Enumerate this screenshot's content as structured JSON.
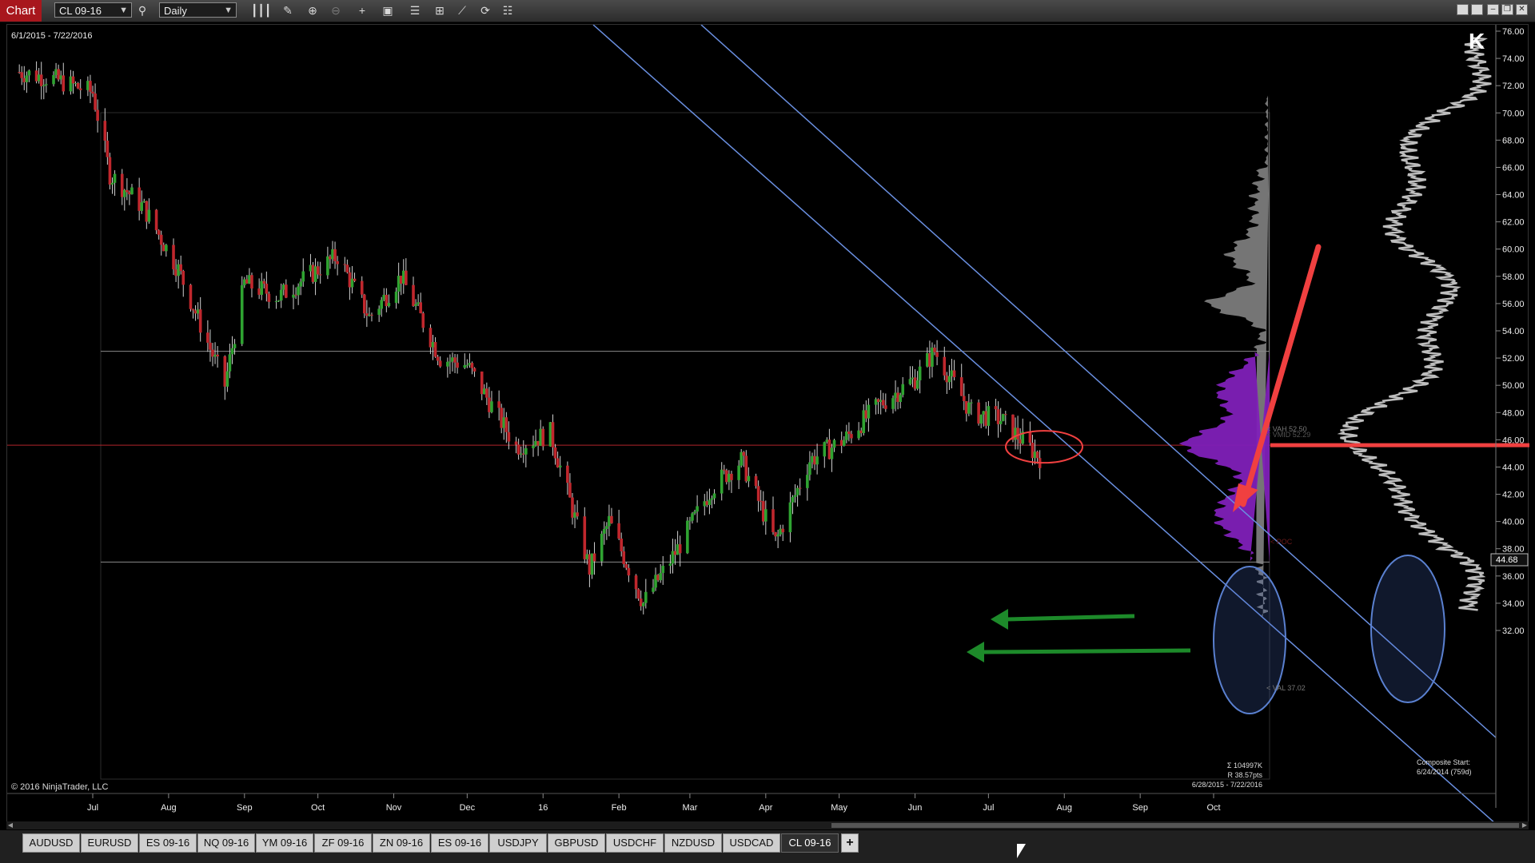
{
  "toolbar": {
    "app_label": "Chart",
    "instrument": "CL 09-16",
    "period": "Daily",
    "icons": [
      "search-icon",
      "bar-type-icon",
      "pencil-icon",
      "zoom-in-icon",
      "zoom-out-icon",
      "crosshair-icon",
      "data-box-icon",
      "indicators-icon",
      "strategies-icon",
      "drawing-tools-icon",
      "refresh-icon",
      "properties-icon"
    ]
  },
  "chart": {
    "date_range": "6/1/2015 - 7/22/2016",
    "copyright": "© 2016 NinjaTrader, LLC",
    "logo_glyph": "K",
    "price_labels": [
      "76.00",
      "74.00",
      "72.00",
      "70.00",
      "68.00",
      "66.00",
      "64.00",
      "62.00",
      "60.00",
      "58.00",
      "56.00",
      "54.00",
      "52.00",
      "50.00",
      "48.00",
      "46.00",
      "44.00",
      "42.00",
      "40.00",
      "38.00",
      "36.00",
      "34.00",
      "32.00"
    ],
    "last_price": "44.68",
    "month_labels": [
      "Jul",
      "Aug",
      "Sep",
      "Oct",
      "Nov",
      "Dec",
      "16",
      "Feb",
      "Mar",
      "Apr",
      "May",
      "Jun",
      "Jul",
      "Aug",
      "Sep",
      "Oct"
    ],
    "volume_profile": {
      "vah_label": "< VAH 52.50",
      "vmid_label": "< VMID 52.29",
      "poc_label": "< POC",
      "val_label": "< VAL 37.02",
      "volume_sum": "Σ 104997K",
      "range": "R 38.57pts",
      "range_dates": "6/28/2015 - 7/22/2016"
    },
    "composite": {
      "title": "Composite Start:",
      "start": "6/24/2014 (759d)"
    },
    "colors": {
      "bull_candle": "#2fa331",
      "bear_candle": "#c0272d",
      "trend_line": "#6a8fe0",
      "poc_line": "#b0242a",
      "profile_fill": "#7f20b8",
      "annotation_red": "#f04040",
      "annotation_green": "#1d8a2a",
      "ellipse_blue": "#5a80d0"
    },
    "chart_data": {
      "type": "candlestick",
      "instrument": "CL 09-16",
      "ylim": [
        32,
        76
      ],
      "y_ticks": [
        76,
        74,
        72,
        70,
        68,
        66,
        64,
        62,
        60,
        58,
        56,
        54,
        52,
        50,
        48,
        46,
        44,
        42,
        40,
        38,
        36,
        34,
        32
      ],
      "x_ticks": [
        "Jul",
        "Aug",
        "Sep",
        "Oct",
        "Nov",
        "Dec",
        "16",
        "Feb",
        "Mar",
        "Apr",
        "May",
        "Jun",
        "Jul",
        "Aug",
        "Sep",
        "Oct"
      ],
      "levels": {
        "vah": 52.5,
        "vmid": 52.29,
        "poc": 45.6,
        "val": 37.02,
        "last": 44.68
      },
      "approx_closes": [
        {
          "t": "2015-06-01",
          "c": 73.0
        },
        {
          "t": "2015-06-15",
          "c": 72.5
        },
        {
          "t": "2015-07-01",
          "c": 71.5
        },
        {
          "t": "2015-07-08",
          "c": 65.5
        },
        {
          "t": "2015-07-22",
          "c": 63.0
        },
        {
          "t": "2015-08-05",
          "c": 58.5
        },
        {
          "t": "2015-08-24",
          "c": 50.0
        },
        {
          "t": "2015-09-01",
          "c": 57.5
        },
        {
          "t": "2015-09-15",
          "c": 56.5
        },
        {
          "t": "2015-10-09",
          "c": 59.5
        },
        {
          "t": "2015-10-22",
          "c": 55.0
        },
        {
          "t": "2015-11-04",
          "c": 58.0
        },
        {
          "t": "2015-11-20",
          "c": 52.0
        },
        {
          "t": "2015-12-01",
          "c": 51.5
        },
        {
          "t": "2015-12-21",
          "c": 45.5
        },
        {
          "t": "2016-01-04",
          "c": 46.5
        },
        {
          "t": "2016-01-20",
          "c": 36.5
        },
        {
          "t": "2016-01-28",
          "c": 40.0
        },
        {
          "t": "2016-02-11",
          "c": 34.0
        },
        {
          "t": "2016-02-25",
          "c": 38.0
        },
        {
          "t": "2016-03-10",
          "c": 42.5
        },
        {
          "t": "2016-03-22",
          "c": 44.5
        },
        {
          "t": "2016-04-05",
          "c": 38.5
        },
        {
          "t": "2016-04-19",
          "c": 44.5
        },
        {
          "t": "2016-05-03",
          "c": 46.0
        },
        {
          "t": "2016-05-17",
          "c": 48.5
        },
        {
          "t": "2016-06-01",
          "c": 50.5
        },
        {
          "t": "2016-06-09",
          "c": 52.5
        },
        {
          "t": "2016-06-24",
          "c": 48.0
        },
        {
          "t": "2016-07-06",
          "c": 47.5
        },
        {
          "t": "2016-07-22",
          "c": 44.7
        }
      ]
    }
  },
  "tabs": [
    "AUDUSD",
    "EURUSD",
    "ES 09-16",
    "NQ 09-16",
    "YM 09-16",
    "ZF 09-16",
    "ZN 09-16",
    "ES 09-16",
    "USDJPY",
    "GBPUSD",
    "USDCHF",
    "NZDUSD",
    "USDCAD",
    "CL 09-16"
  ],
  "active_tab": "CL 09-16",
  "add_tab_label": "+"
}
